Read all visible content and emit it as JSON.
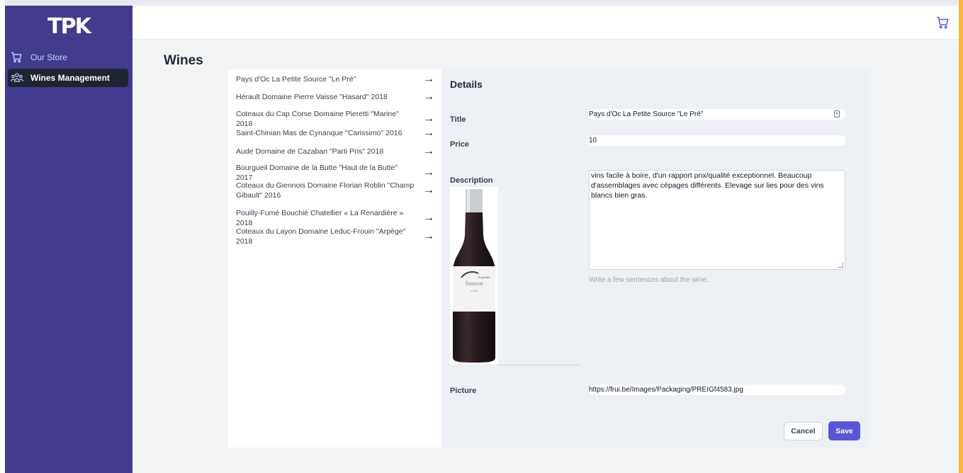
{
  "app": {
    "logo": "TPK"
  },
  "sidebar": {
    "items": [
      {
        "label": "Our Store",
        "icon": "cart-icon",
        "active": false
      },
      {
        "label": "Wines Management",
        "icon": "users-icon",
        "active": true
      }
    ]
  },
  "header": {
    "cart_icon": "cart-icon"
  },
  "page": {
    "title": "Wines"
  },
  "wines": [
    {
      "name": "Pays d'Oc La Petite Source \"Le Pré\""
    },
    {
      "name": "Hérault Domaine Pierre Vaisse \"Hasard\" 2018"
    },
    {
      "name": "Coteaux du Cap Corse Domaine Pieretti \"Marine\" 2018"
    },
    {
      "name": "Saint-Chinian Mas de Cynanque \"Carissimo\" 2016"
    },
    {
      "name": "Aude Domaine de Cazaban \"Parti Pris\" 2018"
    },
    {
      "name": "Bourgueil Domaine de la Butte \"Haut de la Butte\" 2017"
    },
    {
      "name": "Coteaux du Giennois Domaine Florian Roblin \"Champ Gibault\" 2016"
    },
    {
      "name": "Pouilly-Fumé Bouchié Chatellier « La Renardière » 2018"
    },
    {
      "name": "Coteaux du Layon Domaine Leduc-Frouin \"Arpège\" 2018"
    }
  ],
  "details": {
    "heading": "Details",
    "title_label": "Title",
    "title_value": "Pays d'Oc La Petite Source \"Le Pré\"",
    "price_label": "Price",
    "price_value": "10",
    "description_label": "Description",
    "description_value": " vins facile à boire, d'un rapport prix/qualité exceptionnel. Beaucoup d'assemblages avec cépages différents. Elevage sur lies pour des vins blancs bien gras.",
    "description_hint": "Write a few sentences about the wine.",
    "picture_label": "Picture",
    "picture_value": "https://frui.be/Images/Packaging/PREIGf4583.jpg",
    "bottle_label_line1": "la petite",
    "bottle_label_line2": "Source",
    "bottle_label_line3": "LE PRÉ",
    "cancel_label": "Cancel",
    "save_label": "Save"
  },
  "colors": {
    "sidebar_bg": "#433b8e",
    "active_nav_bg": "#1f2433",
    "primary": "#5a56d6",
    "panel_bg": "#edf1f5"
  }
}
